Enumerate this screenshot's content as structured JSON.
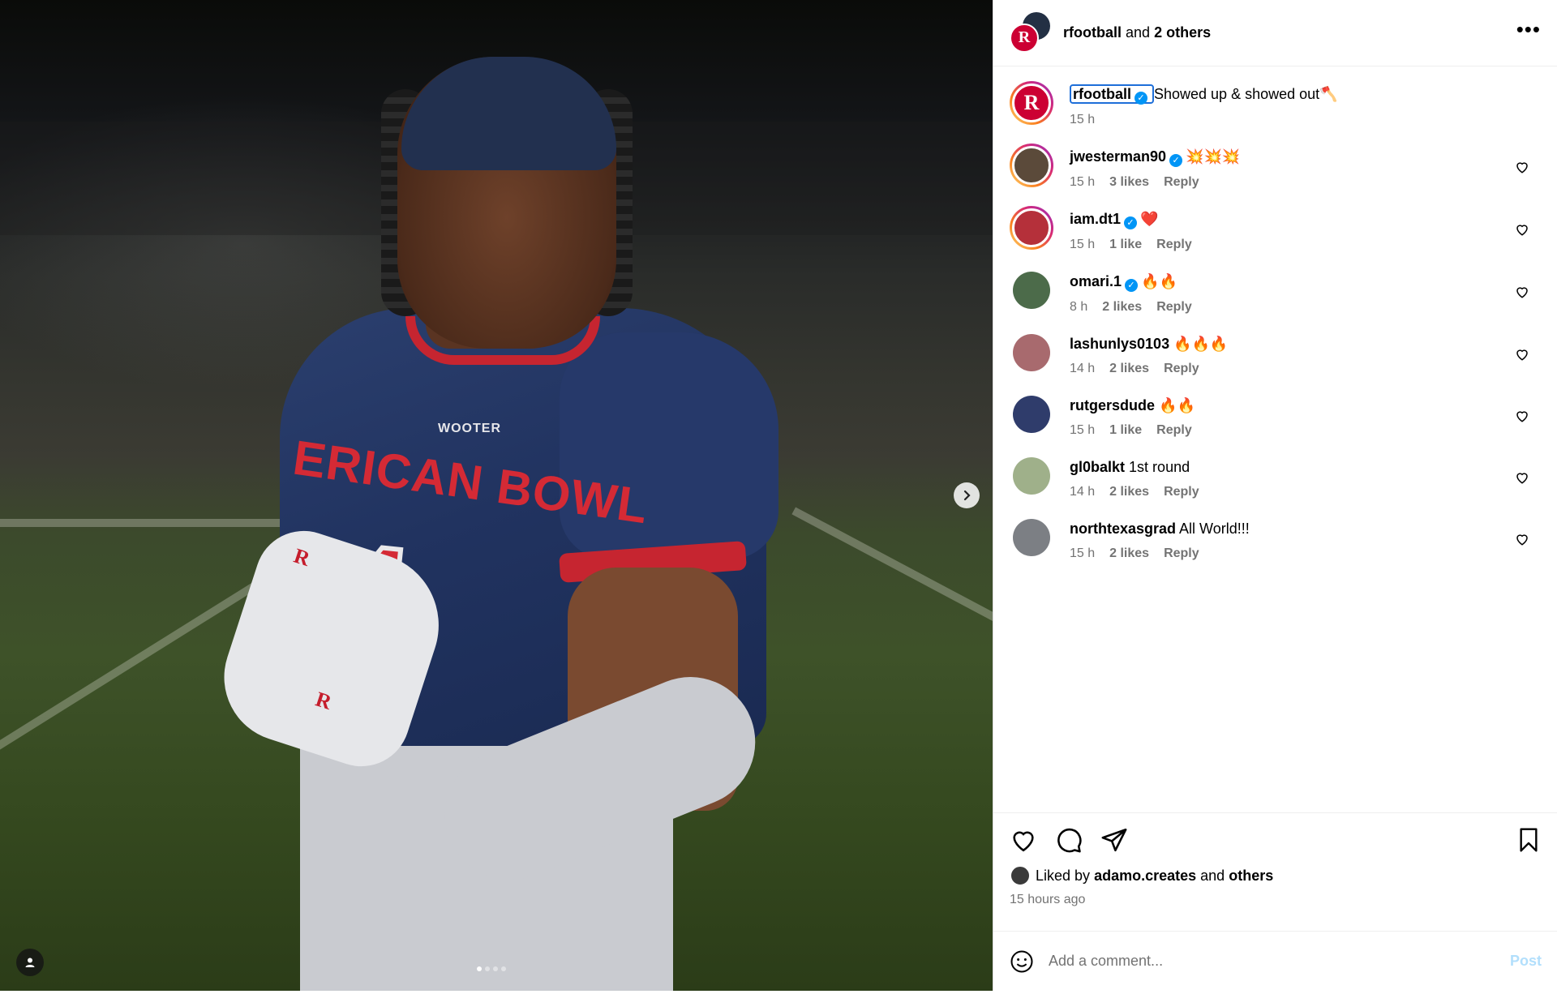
{
  "photo": {
    "jersey_text": "ERICAN BOWL",
    "jersey_number": "4",
    "jersey_brand": "WOOTER",
    "glove_letter": "R",
    "carousel": {
      "total": 4,
      "active_index": 0
    },
    "icons": {
      "next": "chevron-right-icon",
      "tag": "user-tag-icon"
    }
  },
  "header": {
    "account": "rfootball",
    "joiner": "and",
    "others": "2 others",
    "more_label": "•••"
  },
  "caption": {
    "username": "rfootball",
    "verified": true,
    "text": "Showed up & showed out🪓",
    "time": "15 h",
    "avatar_letter": "R"
  },
  "comments": [
    {
      "username": "jwesterman90",
      "verified": true,
      "text": "💥💥💥",
      "time": "15 h",
      "likes": "3 likes",
      "reply": "Reply",
      "avatar_color": "#5b4a3a",
      "ring": true
    },
    {
      "username": "iam.dt1",
      "verified": true,
      "text": "❤️",
      "time": "15 h",
      "likes": "1 like",
      "reply": "Reply",
      "avatar_color": "#b5303a",
      "ring": true
    },
    {
      "username": "omari.1",
      "verified": true,
      "text": "🔥🔥",
      "time": "8 h",
      "likes": "2 likes",
      "reply": "Reply",
      "avatar_color": "#4c6b4a",
      "ring": false
    },
    {
      "username": "lashunlys0103",
      "verified": false,
      "text": "🔥🔥🔥",
      "time": "14 h",
      "likes": "2 likes",
      "reply": "Reply",
      "avatar_color": "#a86a6e",
      "ring": false
    },
    {
      "username": "rutgersdude",
      "verified": false,
      "text": "🔥🔥",
      "time": "15 h",
      "likes": "1 like",
      "reply": "Reply",
      "avatar_color": "#2f3c6b",
      "ring": false
    },
    {
      "username": "gl0balkt",
      "verified": false,
      "text": "1st round",
      "time": "14 h",
      "likes": "2 likes",
      "reply": "Reply",
      "avatar_color": "#9fb08a",
      "ring": false
    },
    {
      "username": "northtexasgrad",
      "verified": false,
      "text": "All World!!!",
      "time": "15 h",
      "likes": "2 likes",
      "reply": "Reply",
      "avatar_color": "#7c7f84",
      "ring": false
    }
  ],
  "actions": {
    "liked_prefix": "Liked by",
    "liked_user": "adamo.creates",
    "liked_joiner": "and",
    "liked_others": "others",
    "time_ago": "15 hours ago",
    "icons": [
      "heart-icon",
      "comment-icon",
      "share-icon",
      "bookmark-icon"
    ]
  },
  "composer": {
    "placeholder": "Add a comment...",
    "post_label": "Post",
    "emoji_icon": "smiley-icon"
  },
  "colors": {
    "accent_blue": "#0095f6",
    "rutgers_red": "#cc0033",
    "muted_text": "#737373",
    "post_disabled": "#b2dffc"
  }
}
